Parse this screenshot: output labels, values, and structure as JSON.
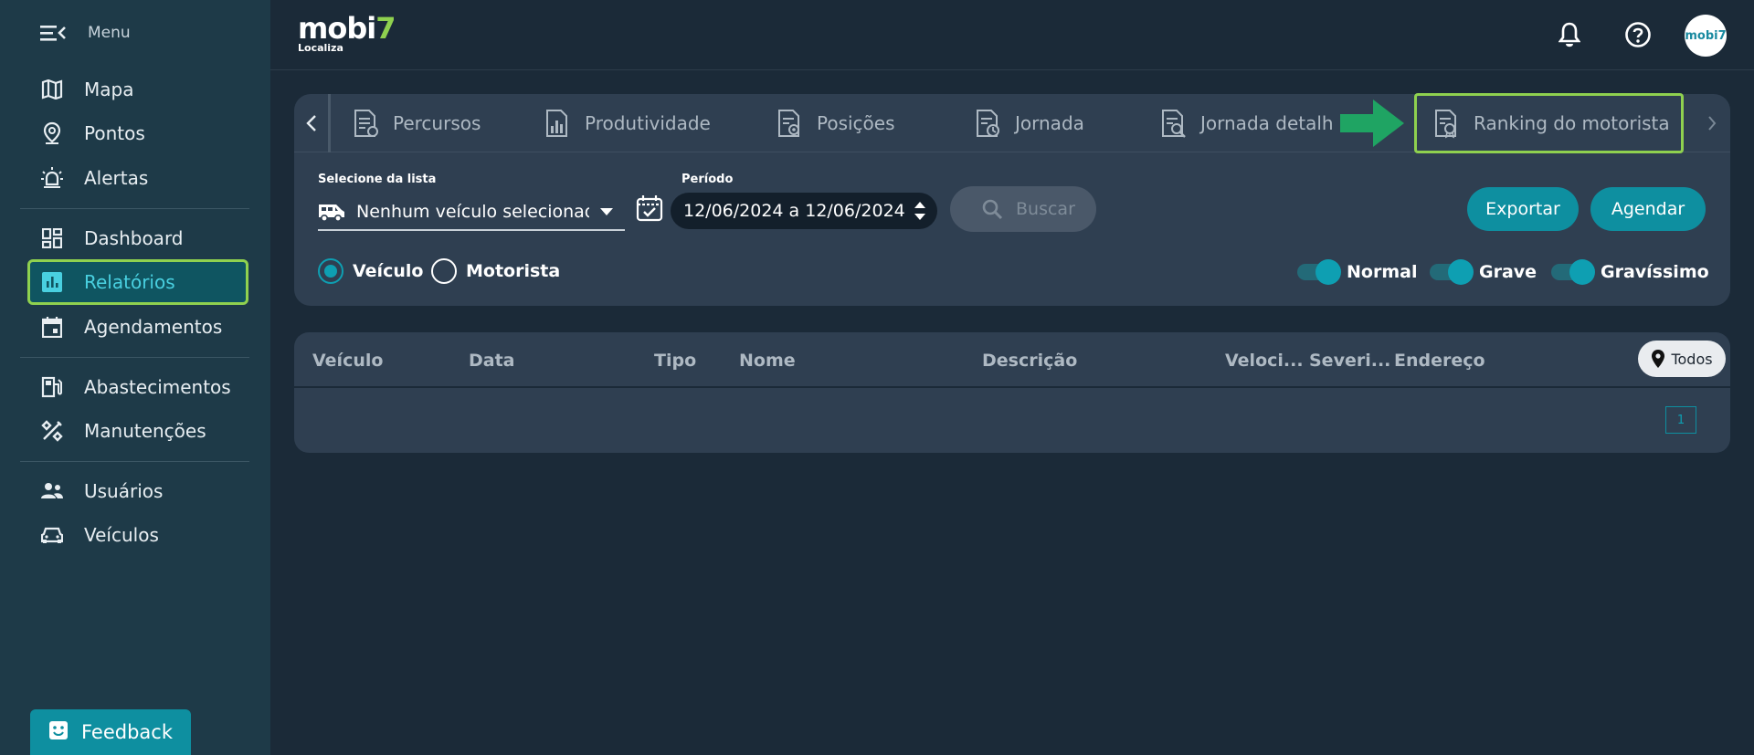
{
  "sidebar": {
    "menu_label": "Menu",
    "items": [
      {
        "label": "Mapa"
      },
      {
        "label": "Pontos"
      },
      {
        "label": "Alertas"
      },
      {
        "label": "Dashboard"
      },
      {
        "label": "Relatórios",
        "active": true
      },
      {
        "label": "Agendamentos"
      },
      {
        "label": "Abastecimentos"
      },
      {
        "label": "Manutenções"
      },
      {
        "label": "Usuários"
      },
      {
        "label": "Veículos"
      }
    ],
    "feedback_label": "Feedback"
  },
  "header": {
    "logo_text": "mobi",
    "logo_number": "7",
    "logo_sub": "Localiza",
    "avatar_text": "mobi7"
  },
  "report_tabs": [
    {
      "label": "Percursos"
    },
    {
      "label": "Produtividade"
    },
    {
      "label": "Posições"
    },
    {
      "label": "Jornada"
    },
    {
      "label": "Jornada detalh"
    },
    {
      "label": "Ranking do motorista",
      "highlighted": true
    }
  ],
  "filters": {
    "vehicle_select_label": "Selecione da lista",
    "vehicle_select_value": "Nenhum veículo selecionad",
    "period_label": "Período",
    "period_value": "12/06/2024 a 12/06/2024",
    "search_label": "Buscar",
    "export_label": "Exportar",
    "schedule_label": "Agendar",
    "radio_options": [
      {
        "label": "Veículo",
        "selected": true
      },
      {
        "label": "Motorista",
        "selected": false
      }
    ],
    "severity_toggles": [
      {
        "label": "Normal",
        "on": true
      },
      {
        "label": "Grave",
        "on": true
      },
      {
        "label": "Gravíssimo",
        "on": true
      }
    ]
  },
  "table": {
    "columns": [
      "Veículo",
      "Data",
      "Tipo",
      "Nome",
      "Descrição",
      "Veloci...",
      "Severi...",
      "Endereço"
    ],
    "todos_label": "Todos",
    "page": "1"
  },
  "colors": {
    "accent": "#0e8fa0",
    "highlight": "#8fd14f",
    "sidebar_bg": "#1e3a48",
    "panel_bg": "#2f3f51"
  }
}
